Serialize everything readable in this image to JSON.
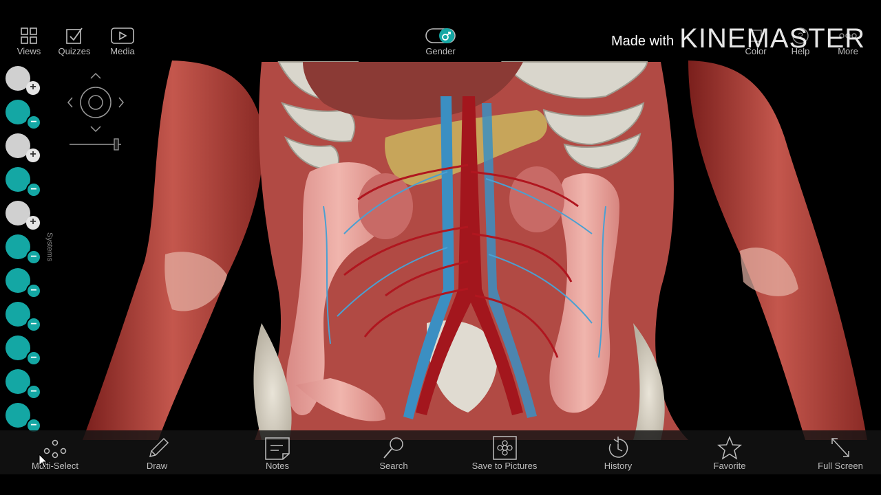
{
  "top_toolbar": {
    "views": "Views",
    "quizzes": "Quizzes",
    "media": "Media",
    "gender": "Gender",
    "color": "Color",
    "help": "Help",
    "more": "More"
  },
  "watermark": {
    "made_with": "Made with",
    "brand": "KINEMASTER"
  },
  "systems": {
    "label": "Systems",
    "accent_color": "#14a7a4",
    "buttons": [
      {
        "name": "skin-system",
        "state": "add"
      },
      {
        "name": "skeletal-system",
        "state": "remove"
      },
      {
        "name": "connective-tissue",
        "state": "add"
      },
      {
        "name": "muscular-system",
        "state": "remove"
      },
      {
        "name": "cardiovascular-system",
        "state": "add"
      },
      {
        "name": "lymphatic-system",
        "state": "remove"
      },
      {
        "name": "nervous-system",
        "state": "remove"
      },
      {
        "name": "respiratory-system",
        "state": "remove"
      },
      {
        "name": "digestive-system",
        "state": "remove"
      },
      {
        "name": "urinary-system",
        "state": "remove"
      },
      {
        "name": "reproductive-system",
        "state": "remove"
      }
    ]
  },
  "bottom_toolbar": {
    "multi_select": "Multi-Select",
    "draw": "Draw",
    "notes": "Notes",
    "search": "Search",
    "save_to_pictures": "Save to Pictures",
    "history": "History",
    "favorite": "Favorite",
    "full_screen": "Full Screen"
  }
}
